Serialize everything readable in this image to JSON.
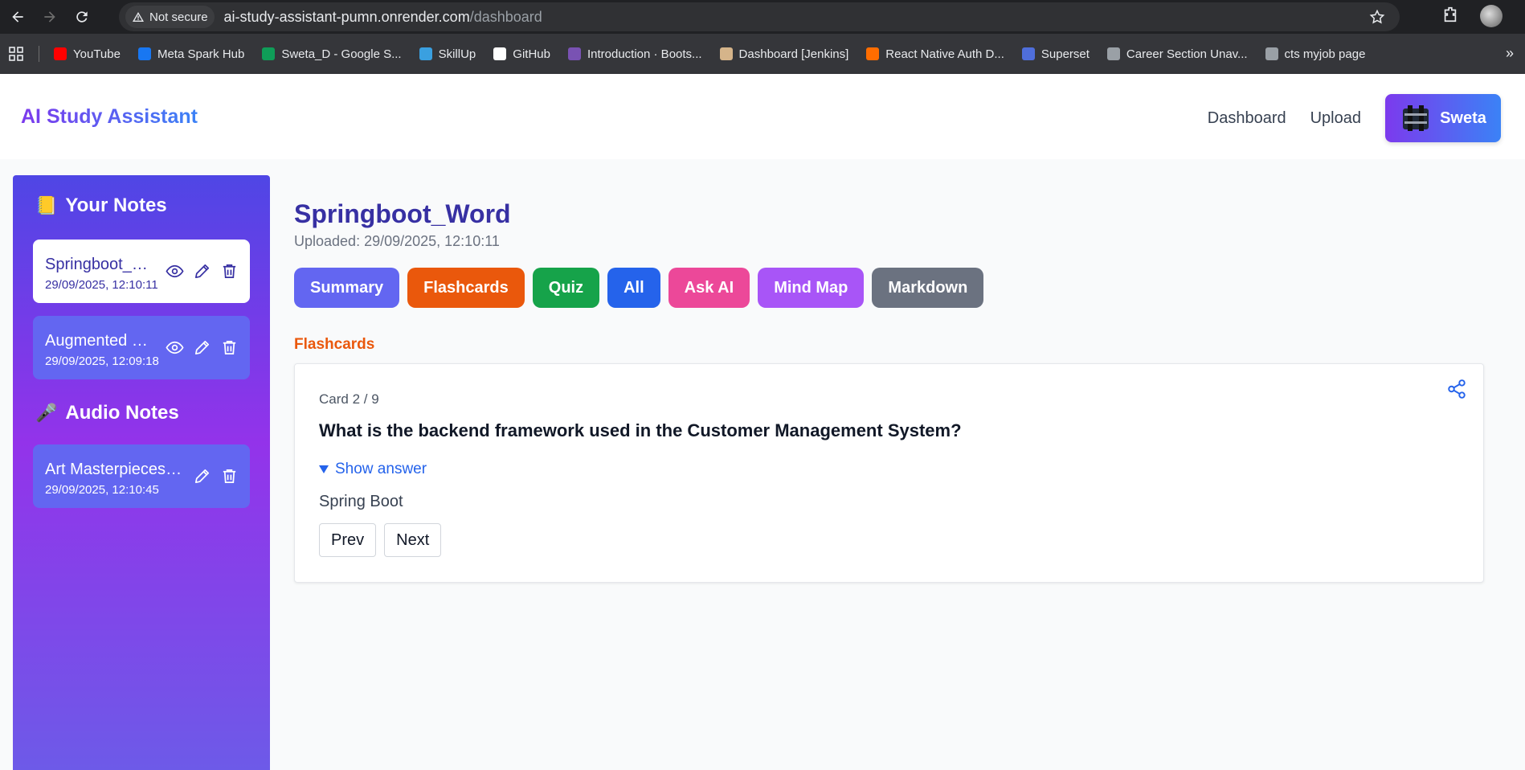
{
  "browser": {
    "security_label": "Not secure",
    "url_host": "ai-study-assistant-pumn.onrender.com",
    "url_path": "/dashboard",
    "bookmarks": [
      {
        "label": "YouTube",
        "color": "#ff0000"
      },
      {
        "label": "Meta Spark Hub",
        "color": "#1877f2"
      },
      {
        "label": "Sweta_D - Google S...",
        "color": "#0f9d58"
      },
      {
        "label": "SkillUp",
        "color": "#3aa0e0"
      },
      {
        "label": "GitHub",
        "color": "#ffffff"
      },
      {
        "label": "Introduction · Boots...",
        "color": "#7952b3"
      },
      {
        "label": "Dashboard [Jenkins]",
        "color": "#d5b48a"
      },
      {
        "label": "React Native Auth D...",
        "color": "#ff6d00"
      },
      {
        "label": "Superset",
        "color": "#4f6edb"
      },
      {
        "label": "Career Section Unav...",
        "color": "#9aa0a6"
      },
      {
        "label": "cts myjob page",
        "color": "#9aa0a6"
      }
    ]
  },
  "header": {
    "brand": "AI Study Assistant",
    "nav": [
      "Dashboard",
      "Upload"
    ],
    "user_name": "Sweta"
  },
  "sidebar": {
    "notes_heading": "Your Notes",
    "notes_emoji": "📒",
    "notes": [
      {
        "title": "Springboot_Word",
        "date": "29/09/2025, 12:10:11",
        "active": true
      },
      {
        "title": "Augmented Reality",
        "date": "29/09/2025, 12:09:18",
        "active": false
      }
    ],
    "audio_heading": "Audio Notes",
    "audio_emoji": "🎤",
    "audio_notes": [
      {
        "title": "Art Masterpieces_Audio",
        "date": "29/09/2025, 12:10:45"
      }
    ]
  },
  "document": {
    "title": "Springboot_Word",
    "uploaded": "Uploaded: 29/09/2025, 12:10:11",
    "tabs": [
      {
        "label": "Summary",
        "color": "#6366f1"
      },
      {
        "label": "Flashcards",
        "color": "#ea580c"
      },
      {
        "label": "Quiz",
        "color": "#16a34a"
      },
      {
        "label": "All",
        "color": "#2563eb"
      },
      {
        "label": "Ask AI",
        "color": "#ec4899"
      },
      {
        "label": "Mind Map",
        "color": "#a855f7"
      },
      {
        "label": "Markdown",
        "color": "#6b7280"
      }
    ],
    "section_label": "Flashcards",
    "card": {
      "counter": "Card 2 / 9",
      "question": "What is the backend framework used in the Customer Management System?",
      "show_answer": "Show answer",
      "answer": "Spring Boot",
      "prev": "Prev",
      "next": "Next"
    }
  }
}
